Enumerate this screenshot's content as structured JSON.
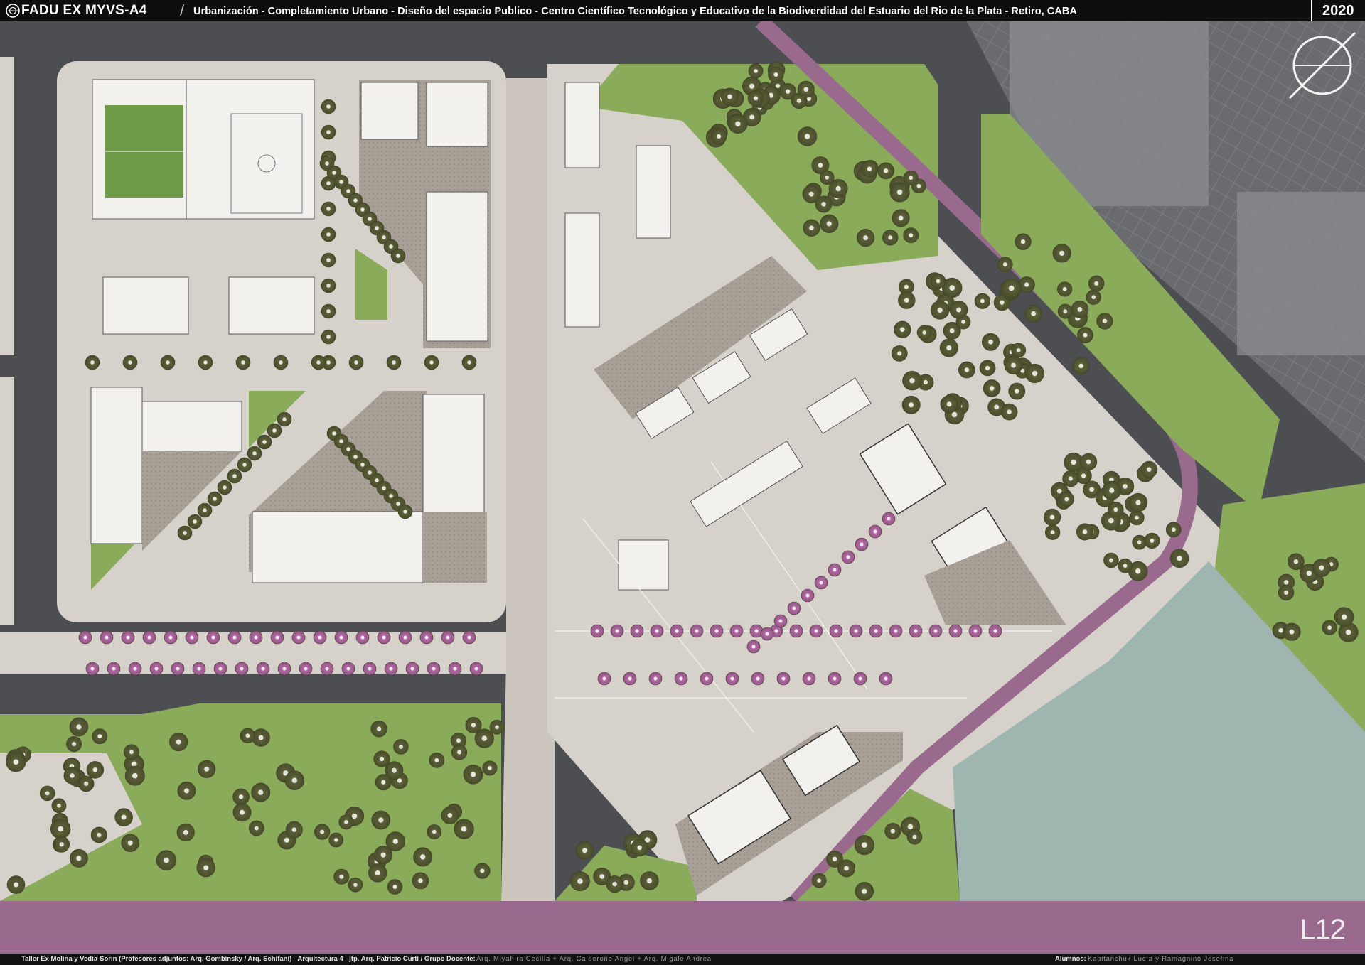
{
  "header": {
    "school": "FADU EX MYVS-A4",
    "topic": "Urbanización - Completamiento Urbano - Diseño del espacio Publico - Centro Científico Tecnológico y Educativo de la Biodiverdidad del Estuario del Rio de la Plata   - Retiro, CABA",
    "year": "2020"
  },
  "sheet": {
    "number": "L12"
  },
  "footer": {
    "credits": "Taller Ex Molina y Vedia-Sorin (Profesores adjuntos:  Arq. Gombinsky / Arq. Schifani) - Arquitectura 4 - jtp. Arq. Patricio Curti / Grupo Docente:",
    "docentes": "Arq. Miyahira Cecilia  +  Arq. Calderone Angel  +  Arq. Migale Andrea",
    "alumnos_label": "Alumnos:",
    "alumnos": "Kapitanchuk Lucía  y  Ramagnino Josefina"
  },
  "colors": {
    "road": "#4d4e52",
    "sidewalk": "#d6d1cb",
    "green": "#8aab59",
    "tree": "#5b5f37",
    "magenta_route": "#9a6a8e",
    "water": "#9fb5b0",
    "plaza": "#a8a097"
  },
  "icons": {
    "logo": "fadu-logo-icon",
    "north": "north-arrow-icon"
  }
}
